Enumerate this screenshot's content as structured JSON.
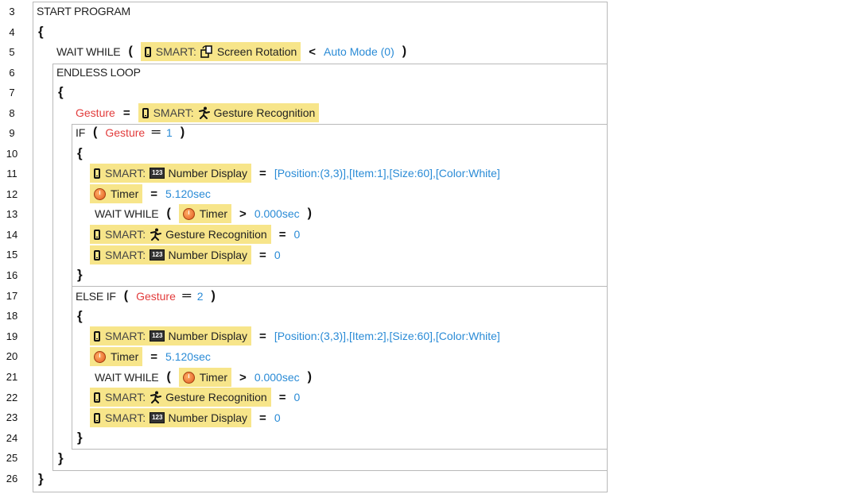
{
  "line_numbers": [
    "3",
    "4",
    "5",
    "6",
    "7",
    "8",
    "9",
    "10",
    "11",
    "12",
    "13",
    "14",
    "15",
    "16",
    "17",
    "18",
    "19",
    "20",
    "21",
    "22",
    "23",
    "24",
    "25",
    "26"
  ],
  "keywords": {
    "start_program": "START PROGRAM",
    "wait_while": "WAIT WHILE",
    "endless_loop": "ENDLESS LOOP",
    "if": "IF",
    "else_if": "ELSE IF",
    "open_brace": "{",
    "close_brace": "}",
    "open_paren": "(",
    "close_paren": ")",
    "assign": "=",
    "equals": "==",
    "less_than": "<",
    "greater_than": ">"
  },
  "smart_label": "SMART:",
  "blocks": {
    "screen_rotation": "Screen Rotation",
    "gesture_recognition": "Gesture Recognition",
    "number_display": "Number Display",
    "timer": "Timer",
    "number_icon_text": "123"
  },
  "variables": {
    "gesture": "Gesture"
  },
  "values": {
    "auto_mode": "Auto Mode (0)",
    "one": "1",
    "two": "2",
    "zero": "0",
    "display_item1": "[Position:(3,3)],[Item:1],[Size:60],[Color:White]",
    "display_item2": "[Position:(3,3)],[Item:2],[Size:60],[Color:White]",
    "timer_set": "5.120sec",
    "timer_zero": "0.000sec"
  }
}
